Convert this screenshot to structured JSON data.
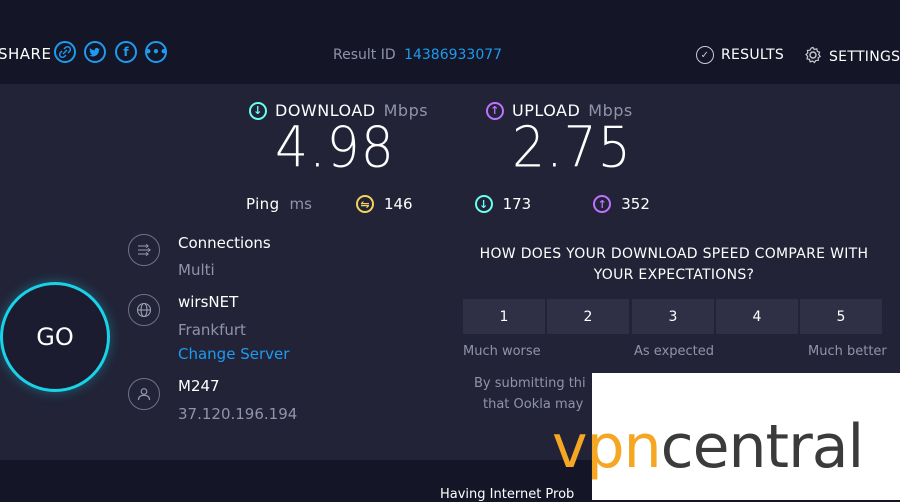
{
  "header": {
    "share_label": "SHARE",
    "share_icons": [
      "link-icon",
      "twitter-icon",
      "facebook-icon",
      "more-icon"
    ],
    "result_id_label": "Result ID",
    "result_id": "14386933077",
    "results_label": "RESULTS",
    "settings_label": "SETTINGS"
  },
  "download": {
    "label": "DOWNLOAD",
    "unit": "Mbps",
    "value": "4.98",
    "color": "#6afff3"
  },
  "upload": {
    "label": "UPLOAD",
    "unit": "Mbps",
    "value": "2.75",
    "color": "#bf71ff"
  },
  "ping": {
    "label": "Ping",
    "unit": "ms",
    "idle": "146",
    "download": "173",
    "upload": "352"
  },
  "connections": {
    "title": "Connections",
    "value": "Multi"
  },
  "server": {
    "name": "wirsNET",
    "location": "Frankfurt",
    "change_label": "Change Server"
  },
  "provider": {
    "name": "M247",
    "ip": "37.120.196.194"
  },
  "go_label": "GO",
  "survey": {
    "question": "HOW DOES YOUR DOWNLOAD SPEED COMPARE WITH YOUR EXPECTATIONS?",
    "ratings": [
      "1",
      "2",
      "3",
      "4",
      "5"
    ],
    "low_label": "Much worse",
    "mid_label": "As expected",
    "high_label": "Much better",
    "disclaimer_line1": "By submitting thi",
    "disclaimer_line2": "that Ookla may"
  },
  "footer_text": "Having Internet Prob",
  "watermark": {
    "part1": "vpn",
    "part2": "central"
  },
  "colors": {
    "accent_blue": "#1d9bf0",
    "go_ring": "#1ad2e8",
    "ping_yellow": "#f1d45d",
    "watermark_orange": "#f5a623"
  }
}
